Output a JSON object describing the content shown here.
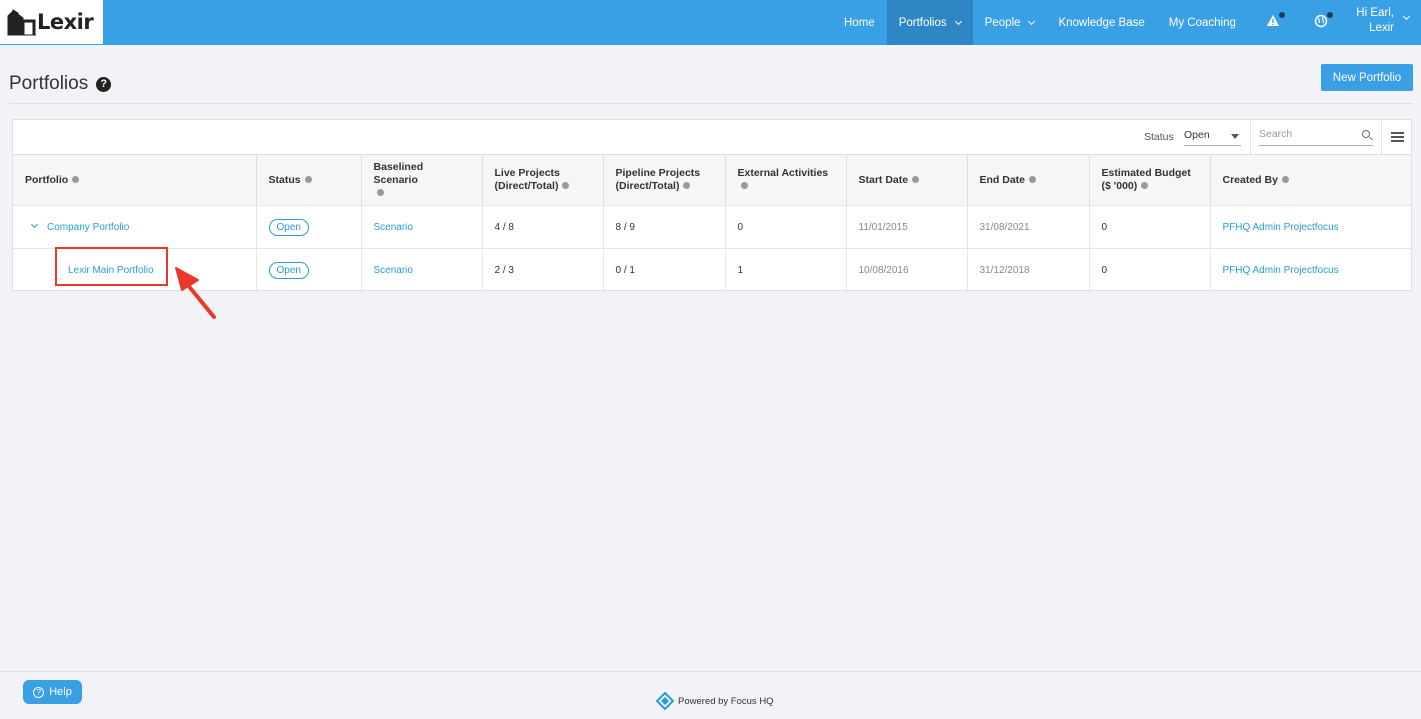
{
  "app": {
    "logo_text": "Lexir"
  },
  "nav": {
    "items": [
      {
        "label": "Home"
      },
      {
        "label": "Portfolios"
      },
      {
        "label": "People"
      },
      {
        "label": "Knowledge Base"
      },
      {
        "label": "My Coaching"
      }
    ],
    "user_greeting": "Hi Earl,",
    "user_name": "Lexir"
  },
  "page": {
    "title": "Portfolios",
    "new_button": "New Portfolio"
  },
  "toolbar": {
    "status_label": "Status",
    "status_value": "Open",
    "search_placeholder": "Search"
  },
  "table": {
    "headers": {
      "portfolio": "Portfolio",
      "status": "Status",
      "baselined_scenario": "Baselined Scenario",
      "live_projects_1": "Live Projects",
      "live_projects_2": "(Direct/Total)",
      "pipeline_projects_1": "Pipeline Projects",
      "pipeline_projects_2": "(Direct/Total)",
      "external_activities": "External Activities",
      "start_date": "Start Date",
      "end_date": "End Date",
      "estimated_budget_1": "Estimated Budget",
      "estimated_budget_2": "($ '000)",
      "created_by": "Created By"
    },
    "rows": [
      {
        "portfolio": "Company Portfolio",
        "status": "Open",
        "scenario": "Scenario",
        "live": "4 / 8",
        "pipeline": "8 / 9",
        "external": "0",
        "start": "11/01/2015",
        "end": "31/08/2021",
        "budget": "0",
        "created_by": "PFHQ Admin Projectfocus"
      },
      {
        "portfolio": "Lexir Main Portfolio",
        "status": "Open",
        "scenario": "Scenario",
        "live": "2 / 3",
        "pipeline": "0 / 1",
        "external": "1",
        "start": "10/08/2016",
        "end": "31/12/2018",
        "budget": "0",
        "created_by": "PFHQ Admin Projectfocus"
      }
    ]
  },
  "footer": {
    "help_label": "Help",
    "powered_by": "Powered by Focus HQ"
  },
  "colors": {
    "primary": "#3aa0e6",
    "nav_active": "#2f86c4",
    "link": "#2b9bd6",
    "annotation": "#e8392a"
  }
}
